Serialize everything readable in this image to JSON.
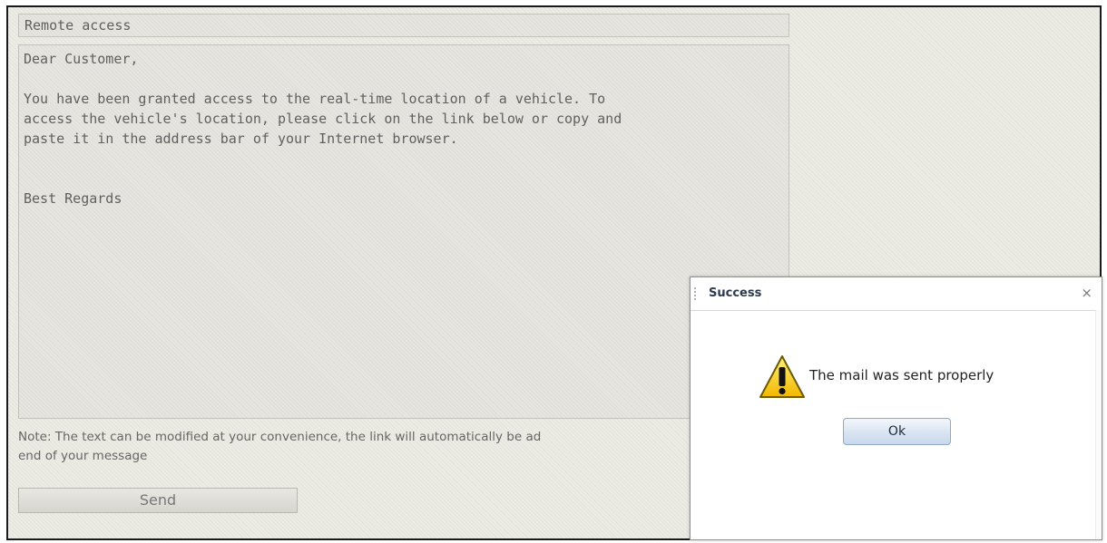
{
  "form": {
    "subject": "Remote access",
    "message": {
      "greeting": "Dear Customer,",
      "paragraph_lines": [
        "You have been granted access to the real-time location of a vehicle. To",
        "access the vehicle's location, please click on the link below or copy and",
        "paste it in the address bar of your Internet browser."
      ],
      "closing": "Best Regards"
    },
    "note_lines": [
      "Note: The text can be modified at your convenience, the link will automatically be ad",
      "end of your message"
    ],
    "send_label": "Send"
  },
  "dialog": {
    "title": "Success",
    "close_glyph": "×",
    "icon": "warning-icon",
    "message": "The mail was sent properly",
    "ok_label": "Ok"
  }
}
